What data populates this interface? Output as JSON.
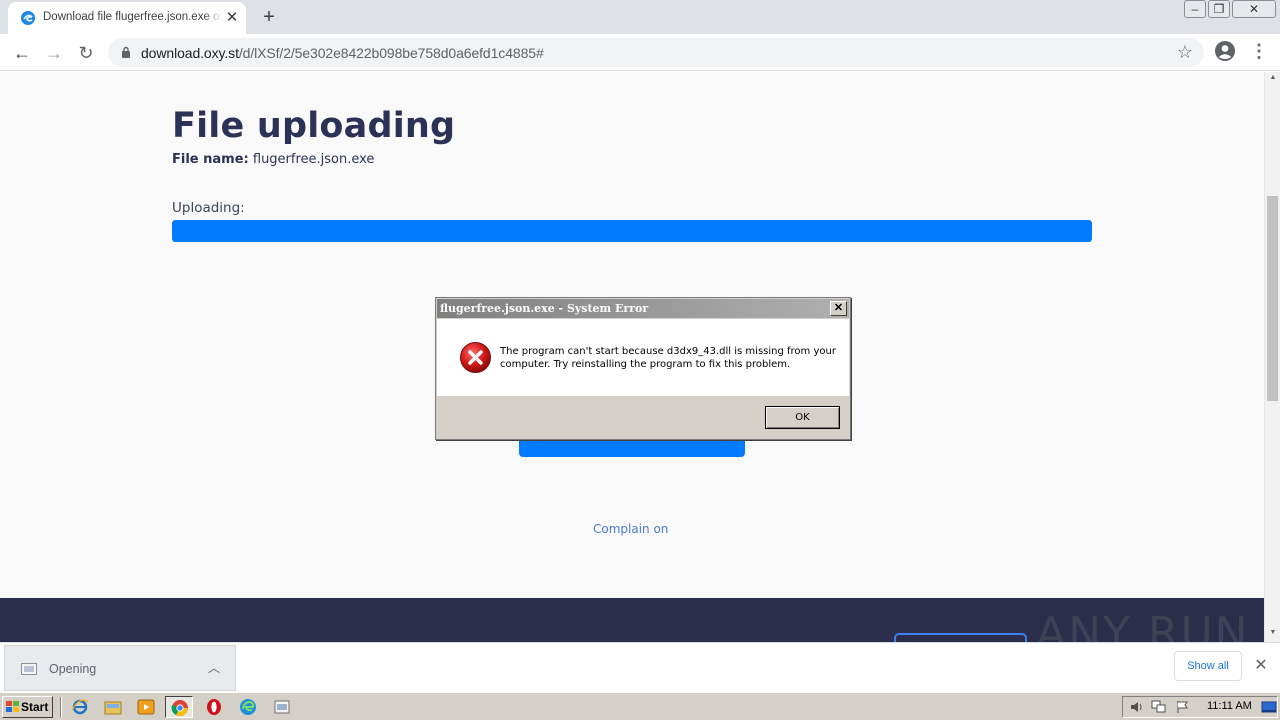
{
  "browser": {
    "tab_title": "Download file flugerfree.json.exe online",
    "url_host": "download.oxy.st",
    "url_path": "/d/lXSf/2/5e302e8422b098be758d0a6efd1c4885#"
  },
  "page": {
    "title": "File uploading",
    "file_name_label": "File name:",
    "file_name_value": "flugerfree.json.exe",
    "uploading_label": "Uploading:",
    "upload_progress_percent": 100,
    "complain_link": "Complain on",
    "accent_color": "#007bff",
    "heading_color": "#2c3255"
  },
  "dialog": {
    "title": "flugerfree.json.exe - System Error",
    "message": "The program can't start because d3dx9_43.dll is missing from your computer. Try reinstalling the program to fix this problem.",
    "ok_label": "OK",
    "close_label": "✕",
    "icon": "error-icon"
  },
  "downloads": {
    "item_status": "Opening",
    "show_all_label": "Show all"
  },
  "watermark": "ANY RUN",
  "taskbar": {
    "start_label": "Start",
    "clock": "11:11 AM",
    "pinned_icons": [
      "ie-icon",
      "explorer-icon",
      "media-player-icon",
      "chrome-icon",
      "opera-icon",
      "edge-icon",
      "window-icon"
    ]
  }
}
